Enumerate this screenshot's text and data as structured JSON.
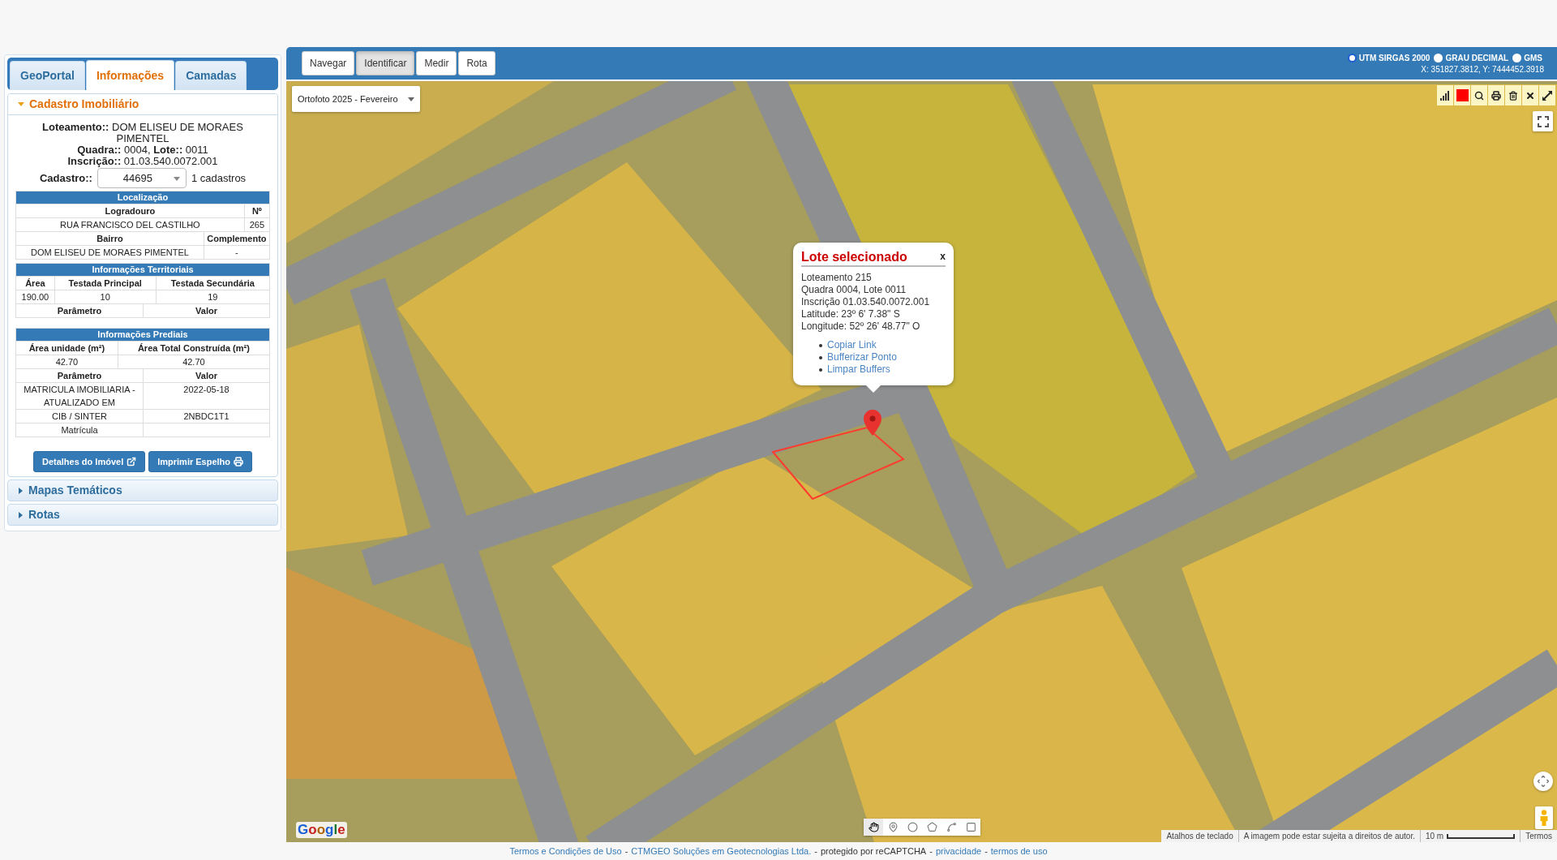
{
  "sidebar": {
    "tabs": [
      {
        "label": "GeoPortal",
        "selected": false
      },
      {
        "label": "Informações",
        "selected": true
      },
      {
        "label": "Camadas",
        "selected": false
      }
    ],
    "sections": [
      {
        "title": "Cadastro Imobiliário",
        "expanded": true,
        "summary": [
          "**Loteamento::** DOM ELISEU DE MORAES PIMENTEL",
          "**Quadra::** 0004, **Lote::** 0011",
          "**Inscrição::** 01.03.540.0072.001"
        ],
        "cadastro": {
          "label": "Cadastro::",
          "value": "44695",
          "count": "1 cadastros"
        },
        "tables": [
          {
            "title": "Localização",
            "rows": [
              {
                "kind": "head",
                "cells": [
                  "Logradouro",
                  "Nº"
                ]
              },
              {
                "kind": "data",
                "cells": [
                  "RUA FRANCISCO DEL CASTILHO",
                  "265"
                ]
              },
              {
                "kind": "head",
                "cells": [
                  "Bairro",
                  "Complemento"
                ]
              },
              {
                "kind": "data",
                "cells": [
                  "DOM ELISEU DE MORAES PIMENTEL",
                  "-"
                ]
              }
            ]
          },
          {
            "title": "Informações Territoriais",
            "rows": [
              {
                "kind": "head",
                "cells": [
                  "Área",
                  "Testada Principal",
                  "Testada Secundária"
                ]
              },
              {
                "kind": "data",
                "cells": [
                  "190.00",
                  "10",
                  "19"
                ]
              }
            ]
          },
          {
            "rows": [
              {
                "kind": "head",
                "cells": [
                  "Parâmetro",
                  "Valor"
                ]
              }
            ]
          },
          {
            "title": "Informações Prediais",
            "rows": [
              {
                "kind": "head",
                "cells": [
                  "Área unidade (m²)",
                  "Área Total Construída (m²)"
                ]
              },
              {
                "kind": "data",
                "cells": [
                  "42.70",
                  "42.70"
                ]
              }
            ]
          },
          {
            "rows": [
              {
                "kind": "head",
                "cells": [
                  "Parâmetro",
                  "Valor"
                ]
              },
              {
                "kind": "data",
                "cells": [
                  "MATRICULA IMOBILIARIA - ATUALIZADO EM",
                  "2022-05-18"
                ]
              },
              {
                "kind": "data",
                "cells": [
                  "CIB / SINTER",
                  "2NBDC1T1"
                ]
              },
              {
                "kind": "data",
                "cells": [
                  "Matrícula"
                ]
              }
            ]
          }
        ],
        "buttons": [
          "Detalhes do Imóvel",
          "Imprimir Espelho"
        ]
      },
      {
        "title": "Mapas Temáticos",
        "expanded": false
      },
      {
        "title": "Rotas",
        "expanded": false
      }
    ]
  },
  "map": {
    "tools": [
      {
        "label": "Navegar",
        "selected": false
      },
      {
        "label": "Identificar",
        "selected": true
      },
      {
        "label": "Medir",
        "selected": false
      },
      {
        "label": "Rota",
        "selected": false
      }
    ],
    "coordinate_systems": [
      {
        "label": "UTM SIRGAS 2000",
        "selected": true
      },
      {
        "label": "GRAU DECIMAL",
        "selected": false
      },
      {
        "label": "GMS",
        "selected": false
      }
    ],
    "cursor_position": "X: 351827.3812, Y: 7444452.3918",
    "basemap": "Ortofoto 2025 - Fevereiro",
    "color_swatch": {
      "color": "#ff0000"
    },
    "popup": {
      "title": "Lote selecionado",
      "close": "x",
      "lines": [
        "Loteamento 215",
        "Quadra 0004, Lote 0011",
        "Inscrição 01.03.540.0072.001",
        "Latitude: 23º 6' 7.38\" S",
        "Longitude: 52º 26' 48.77\" O"
      ],
      "links": [
        "Copiar Link",
        "Bufferizar Ponto",
        "Limpar Buffers"
      ]
    },
    "logo": "Google",
    "drawing_tools": [
      {
        "selected": true
      },
      {
        "selected": false
      },
      {
        "selected": false
      },
      {
        "selected": false
      },
      {
        "selected": false
      },
      {
        "selected": false
      }
    ],
    "attribution": [
      {
        "kind": "text",
        "text": "Atalhos de teclado"
      },
      {
        "kind": "text",
        "text": "A imagem pode estar sujeita a direitos de autor."
      },
      {
        "kind": "scale",
        "text": "10 m"
      },
      {
        "kind": "text",
        "text": "Termos"
      }
    ]
  },
  "footer": {
    "parts": [
      {
        "kind": "link",
        "text": "Termos e Condições de Uso"
      },
      {
        "kind": "separator",
        "text": "-"
      },
      {
        "kind": "link",
        "text": "CTMGEO Soluções em Geotecnologias Ltda."
      },
      {
        "kind": "separator",
        "text": "-"
      },
      {
        "kind": "text",
        "text": "protegido por reCAPTCHA"
      },
      {
        "kind": "separator",
        "text": "-"
      },
      {
        "kind": "link",
        "text": "privacidade"
      },
      {
        "kind": "separator",
        "text": "-"
      },
      {
        "kind": "link",
        "text": "termos de uso"
      }
    ]
  }
}
